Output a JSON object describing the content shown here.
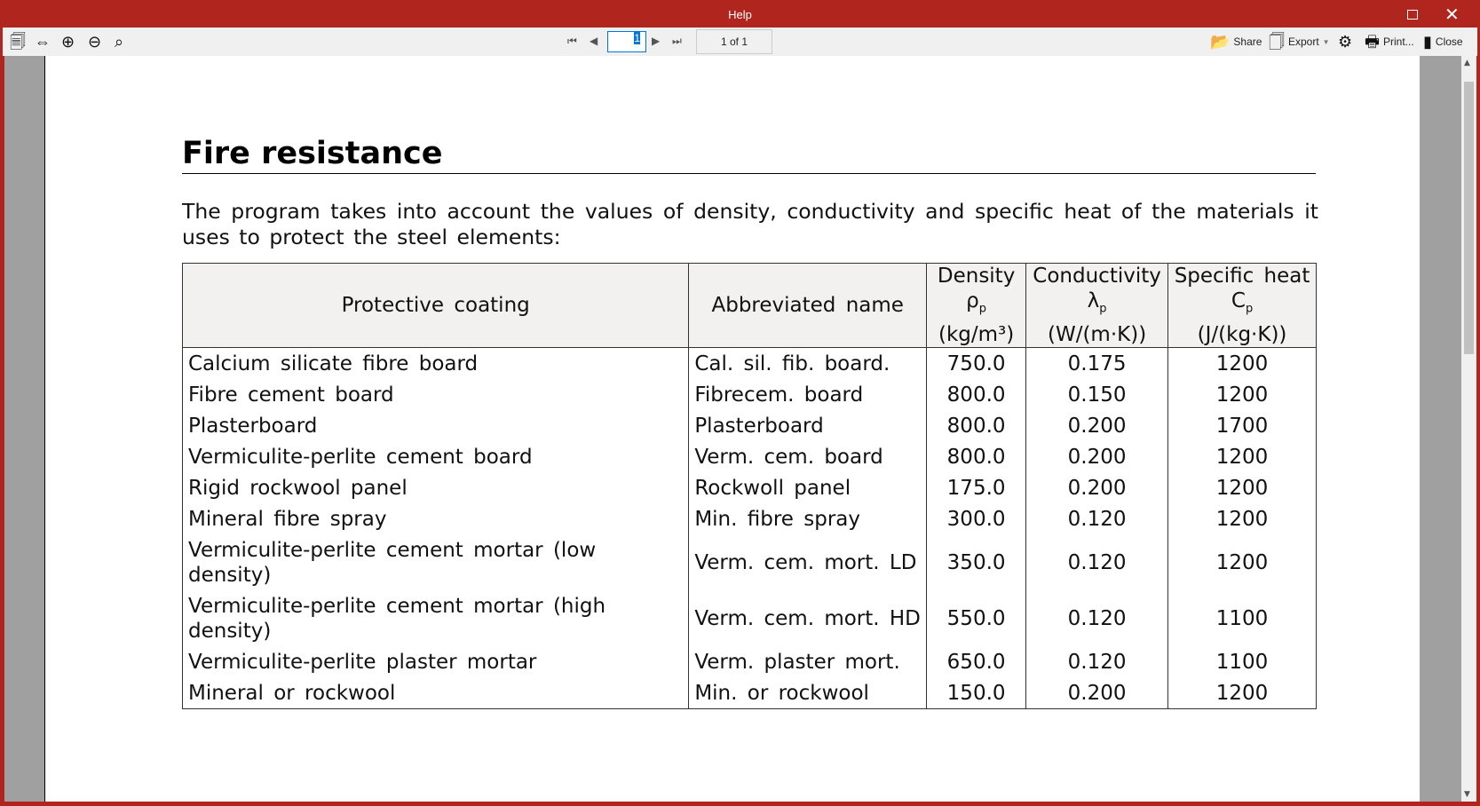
{
  "window": {
    "title": "Help"
  },
  "toolbar": {
    "page_value": "1",
    "page_of": "1 of 1",
    "share": "Share",
    "export": "Export",
    "print": "Print...",
    "close": "Close"
  },
  "doc": {
    "heading": "Fire resistance",
    "intro": "The program takes into account the values of density, conductivity and specific heat of the materials it uses to protect the steel elements:",
    "headers": [
      {
        "l1": "Protective coating"
      },
      {
        "l1": "Abbreviated name"
      },
      {
        "l1": "Density",
        "sym": "ρ",
        "sub": "p",
        "unit": "(kg/m³)"
      },
      {
        "l1": "Conductivity",
        "sym": "λ",
        "sub": "p",
        "unit": "(W/(m·K))"
      },
      {
        "l1": "Specific heat",
        "sym": "C",
        "sub": "p",
        "unit": "(J/(kg·K))"
      }
    ],
    "rows": [
      [
        "Calcium silicate fibre board",
        "Cal. sil. fib. board.",
        "750.0",
        "0.175",
        "1200"
      ],
      [
        "Fibre cement board",
        "Fibrecem. board",
        "800.0",
        "0.150",
        "1200"
      ],
      [
        "Plasterboard",
        "Plasterboard",
        "800.0",
        "0.200",
        "1700"
      ],
      [
        "Vermiculite-perlite cement board",
        "Verm. cem. board",
        "800.0",
        "0.200",
        "1200"
      ],
      [
        "Rigid rockwool panel",
        "Rockwoll panel",
        "175.0",
        "0.200",
        "1200"
      ],
      [
        "Mineral fibre spray",
        "Min. fibre spray",
        "300.0",
        "0.120",
        "1200"
      ],
      [
        "Vermiculite-perlite cement mortar (low density)",
        "Verm. cem. mort. LD",
        "350.0",
        "0.120",
        "1200"
      ],
      [
        "Vermiculite-perlite cement mortar (high density)",
        "Verm. cem. mort. HD",
        "550.0",
        "0.120",
        "1100"
      ],
      [
        "Vermiculite-perlite plaster mortar",
        "Verm. plaster mort.",
        "650.0",
        "0.120",
        "1100"
      ],
      [
        "Mineral or rockwool",
        "Min. or rockwool",
        "150.0",
        "0.200",
        "1200"
      ]
    ]
  }
}
